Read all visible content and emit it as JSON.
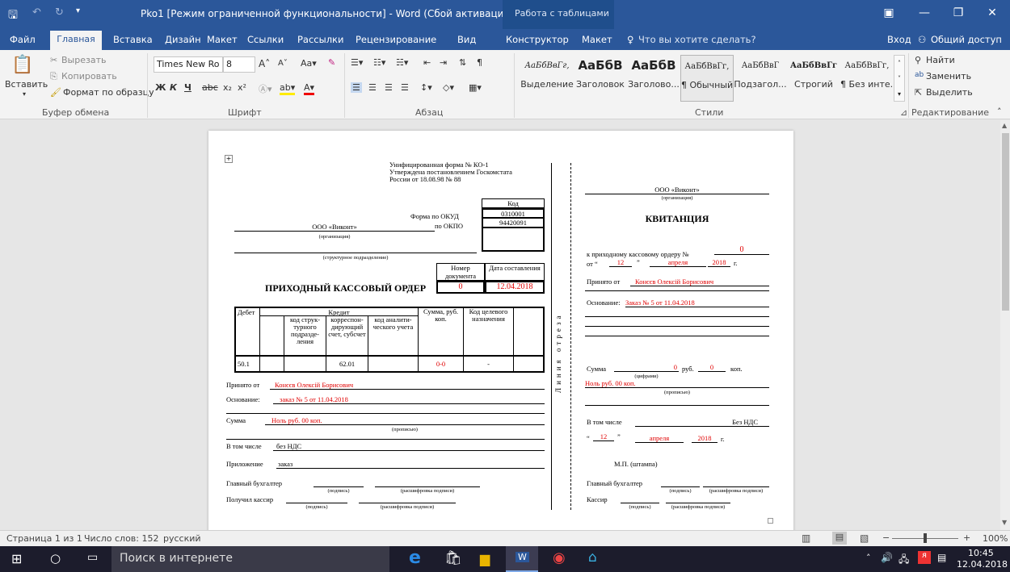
{
  "title_bar": {
    "title": "Рko1 [Режим ограниченной функциональности] - Word (Сбой активации продукта)",
    "context_group": "Работа с таблицами"
  },
  "tabs": [
    "Файл",
    "Главная",
    "Вставка",
    "Дизайн",
    "Макет",
    "Ссылки",
    "Рассылки",
    "Рецензирование",
    "Вид",
    "Конструктор",
    "Макет"
  ],
  "tell_me": "Что вы хотите сделать?",
  "login": "Вход",
  "share": "Общий доступ",
  "clipboard": {
    "paste": "Вставить",
    "cut": "Вырезать",
    "copy": "Копировать",
    "format_painter": "Формат по образцу",
    "group": "Буфер обмена"
  },
  "font": {
    "name": "Times New Ro",
    "size": "8",
    "group": "Шрифт"
  },
  "paragraph": {
    "group": "Абзац"
  },
  "styles": {
    "items": [
      {
        "sample": "АаБбВвГг,",
        "label": "Выделение"
      },
      {
        "sample": "АаБбВ",
        "label": "Заголовок"
      },
      {
        "sample": "АаБбВ",
        "label": "Заголово..."
      },
      {
        "sample": "АаБбВвГг,",
        "label": "¶ Обычный"
      },
      {
        "sample": "АаБбВвГ",
        "label": "Подзагол..."
      },
      {
        "sample": "АаБбВвГг",
        "label": "Строгий"
      },
      {
        "sample": "АаБбВвГг,",
        "label": "¶ Без инте..."
      }
    ],
    "group": "Стили"
  },
  "editing": {
    "find": "Найти",
    "replace": "Заменить",
    "select": "Выделить",
    "group": "Редактирование"
  },
  "doc": {
    "left": {
      "form_header": [
        "Унифицированная форма № КО-1",
        "Утверждена постановлением Госкомстата",
        "России от 18.08.98 № 88"
      ],
      "code_label": "Код",
      "okud_label": "Форма по ОКУД",
      "okud": "0310001",
      "okpo_label": "по ОКПО",
      "okpo": "94420091",
      "org": "ООО «Виконт»",
      "org_caption": "(организация)",
      "subdiv_caption": "(структурное подразделение)",
      "doc_no_label": "Номер документа",
      "doc_date_label": "Дата составления",
      "title": "ПРИХОДНЫЙ КАССОВЫЙ ОРДЕР",
      "doc_no": "0",
      "doc_date": "12.04.2018",
      "table_headers": {
        "debit": "Дебет",
        "credit": "Кредит",
        "sub1": "код струк-турного подразде-ления",
        "sub2": "корреспон-дирующий счет, субсчет",
        "sub3": "код аналити-ческого учета",
        "sum": "Сумма, руб. коп.",
        "purpose": "Код целевого назначения"
      },
      "row": {
        "debit": "50.1",
        "account": "62.01",
        "sum": "0-0",
        "purpose": "-"
      },
      "received_from_label": "Принято от",
      "received_from": "Конєєв Олексій Борисович",
      "basis_label": "Основание:",
      "basis": "заказ № 5 от 11.04.2018",
      "sum_label": "Сумма",
      "sum_words": "Ноль руб. 00 коп.",
      "sum_caption": "(прописью)",
      "incl_label": "В том числе",
      "incl": "без НДС",
      "attach_label": "Приложение",
      "attach": "заказ",
      "chief_label": "Главный бухгалтер",
      "sign_caption": "(подпись)",
      "decode_caption": "(расшифровка подписи)",
      "cashier_label": "Получил кассир"
    },
    "cut_line": "Линия отреза",
    "right": {
      "org": "ООО «Виконт»",
      "org_caption": "(организация)",
      "title": "КВИТАНЦИЯ",
      "order_label": "к приходному кассовому ордеру №",
      "order_no": "0",
      "from_label": "от",
      "day": "12",
      "month": "апреля",
      "year": "2018",
      "year_suffix": "г.",
      "received_label": "Принято от",
      "received": "Конєєв Олексій Борисович",
      "basis_label": "Основание:",
      "basis": "Заказ № 5 от 11.04.2018",
      "sum_label": "Сумма",
      "rub_value": "0",
      "rub": "руб.",
      "kop_value": "0",
      "kop": "коп.",
      "digits_caption": "(цифрами)",
      "sum_words": "Ноль руб. 00 коп.",
      "words_caption": "(прописью)",
      "incl_label": "В том числе",
      "incl": "Без НДС",
      "day2": "12",
      "month2": "апреля",
      "year2": "2018",
      "stamp": "М.П. (штампа)",
      "chief_label": "Главный бухгалтер",
      "sign_caption": "(подпись)",
      "decode_caption": "(расшифровка подписи)",
      "cashier_label": "Кассир"
    }
  },
  "status": {
    "page": "Страница 1 из 1",
    "words": "Число слов: 152",
    "lang": "русский",
    "zoom": "100%"
  },
  "taskbar": {
    "search": "Поиск в интернете",
    "time": "10:45",
    "date": "12.04.2018"
  },
  "colors": {
    "accent": "#2b579a",
    "red_text": "#e00000",
    "taskbar": "#1c1c2c"
  }
}
